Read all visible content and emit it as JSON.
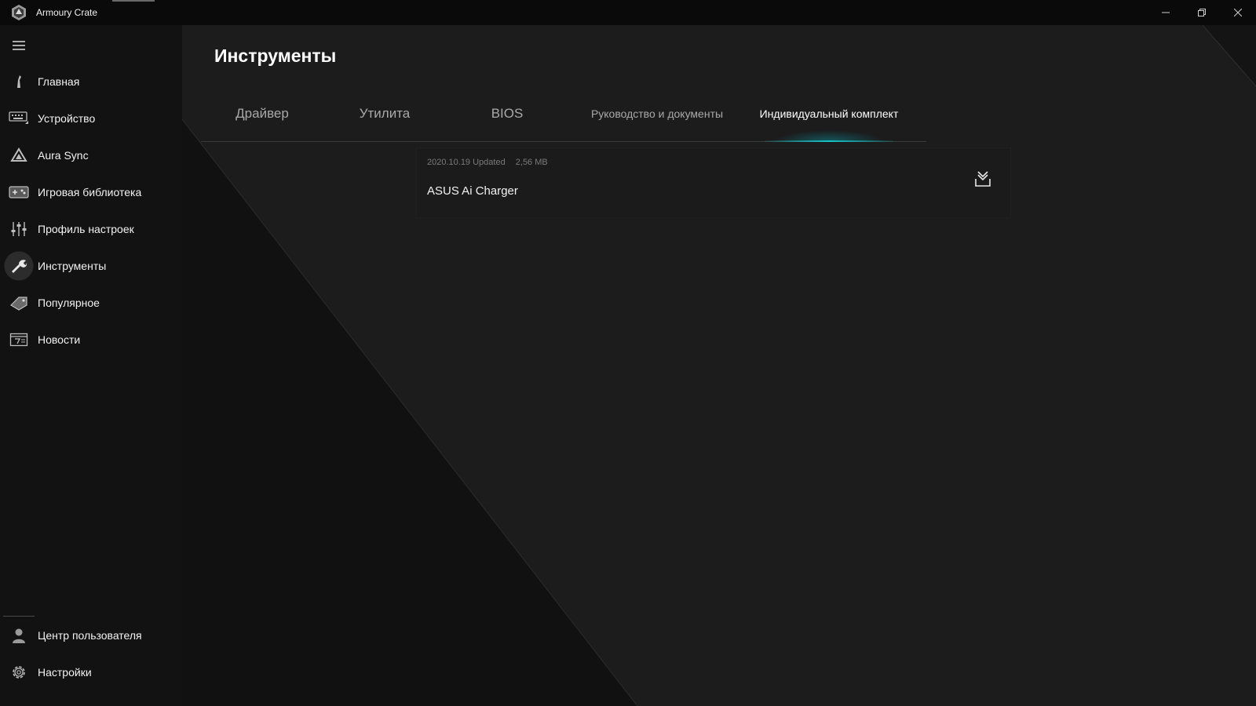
{
  "window": {
    "title": "Armoury Crate",
    "controls": [
      "minimize",
      "restore",
      "close"
    ]
  },
  "sidebar": {
    "items": [
      {
        "label": "Главная",
        "icon": "home-icon"
      },
      {
        "label": "Устройство",
        "icon": "device-icon"
      },
      {
        "label": "Aura Sync",
        "icon": "aura-sync-icon"
      },
      {
        "label": "Игровая библиотека",
        "icon": "game-library-icon"
      },
      {
        "label": "Профиль настроек",
        "icon": "scenario-profile-icon"
      },
      {
        "label": "Инструменты",
        "icon": "tools-icon",
        "active": true
      },
      {
        "label": "Популярное",
        "icon": "featured-icon"
      },
      {
        "label": "Новости",
        "icon": "news-icon"
      }
    ],
    "bottom_items": [
      {
        "label": "Центр пользователя",
        "icon": "user-icon"
      },
      {
        "label": "Настройки",
        "icon": "gear-icon"
      }
    ]
  },
  "main": {
    "title": "Инструменты",
    "tabs": [
      {
        "label": "Драйвер"
      },
      {
        "label": "Утилита"
      },
      {
        "label": "BIOS"
      },
      {
        "label": "Руководство и документы"
      },
      {
        "label": "Индивидуальный комплект",
        "active": true
      }
    ],
    "items": [
      {
        "updated": "2020.10.19 Updated",
        "size": "2,56 MB",
        "name": "ASUS Ai Charger",
        "action_icon": "download-icon"
      }
    ]
  },
  "colors": {
    "accent": "#13c3c7",
    "background": "#1c1c1d",
    "sidebar": "#121212"
  }
}
